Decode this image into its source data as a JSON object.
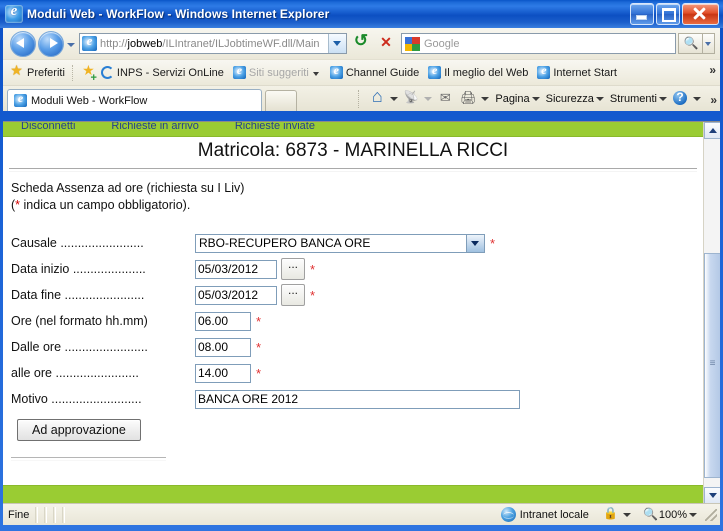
{
  "window": {
    "title": "Moduli Web - WorkFlow - Windows Internet Explorer",
    "icon": "internet-explorer-icon",
    "minimize_label": "Riduci a icona",
    "maximize_label": "Ingrandisci",
    "close_label": "Chiudi"
  },
  "address_bar": {
    "back_label": "Indietro",
    "forward_label": "Avanti",
    "history_dropdown_label": "Pagine recenti",
    "url_prefix": "http://",
    "url_host": "jobweb",
    "url_path": "/ILIntranet/ILJobtimeWF.dll/Main",
    "url_full": "http://jobweb/ILIntranet/ILJobtimeWF.dll/Main",
    "refresh_label": "Aggiorna",
    "stop_label": "Interrompi",
    "search_placeholder": "Google",
    "search_go_label": "Cerca",
    "search_provider": "Google"
  },
  "favorites_bar": {
    "favorites_label": "Preferiti",
    "add_to_favorites_label": "Aggiungi a Preferiti",
    "items": [
      {
        "label": "INPS - Servizi OnLine",
        "icon": "inps-icon"
      },
      {
        "label": "Siti suggeriti",
        "icon": "ie-icon",
        "dim": true,
        "has_caret": true
      },
      {
        "label": "Channel Guide",
        "icon": "ie-icon"
      },
      {
        "label": "Il meglio del Web",
        "icon": "ie-icon"
      },
      {
        "label": "Internet Start",
        "icon": "ie-icon"
      }
    ],
    "overflow_label": "»"
  },
  "tab_bar": {
    "tab_title": "Moduli Web - WorkFlow",
    "new_tab_label": "Nuova scheda"
  },
  "command_bar": {
    "home_label": "Pagina iniziale",
    "feeds_label": "Feed",
    "mail_label": "Posta",
    "print_label": "Stampa",
    "menus": [
      {
        "label": "Pagina"
      },
      {
        "label": "Sicurezza"
      },
      {
        "label": "Strumenti"
      }
    ],
    "help_label": "Guida",
    "overflow_label": "»"
  },
  "page": {
    "nav_links": [
      "Disconnetti",
      "Richieste in arrivo",
      "Richieste inviate"
    ],
    "heading": "Matricola: 6873 - MARINELLA RICCI",
    "intro_line1": "Scheda Assenza ad ore (richiesta su I Liv)",
    "intro_line2_pre": "(",
    "intro_line2_star": "*",
    "intro_line2_post": " indica un campo obbligatorio).",
    "required_marker": "*",
    "fields": [
      {
        "label": "Causale ........................",
        "type": "select",
        "value": "RBO-RECUPERO BANCA ORE",
        "required": true,
        "name": "causale"
      },
      {
        "label": "Data inizio .....................",
        "type": "date",
        "value": "05/03/2012",
        "picker_label": "...",
        "required": true,
        "name": "data-inizio"
      },
      {
        "label": "Data fine .......................",
        "type": "date",
        "value": "05/03/2012",
        "picker_label": "...",
        "required": true,
        "name": "data-fine"
      },
      {
        "label": "Ore (nel formato hh.mm)",
        "type": "hour",
        "value": "06.00",
        "required": true,
        "name": "ore"
      },
      {
        "label": "Dalle ore ........................",
        "type": "hour",
        "value": "08.00",
        "required": true,
        "name": "dalle-ore"
      },
      {
        "label": "alle ore ........................",
        "type": "hour",
        "value": "14.00",
        "required": true,
        "name": "alle-ore"
      },
      {
        "label": "Motivo ..........................",
        "type": "text",
        "value": "BANCA ORE 2012",
        "required": false,
        "name": "motivo"
      }
    ],
    "submit_label": "Ad approvazione"
  },
  "status_bar": {
    "status_text": "Fine",
    "zone_label": "Intranet locale",
    "zone_icon": "globe-icon",
    "protected_mode_icon": "lock-icon",
    "zoom_level": "100%",
    "zoom_icon": "zoom-icon"
  },
  "colors": {
    "nav_green": "#9ACC33",
    "title_blue": "#1A62D6",
    "required_red": "#e03030",
    "link_blue": "#23408e"
  }
}
